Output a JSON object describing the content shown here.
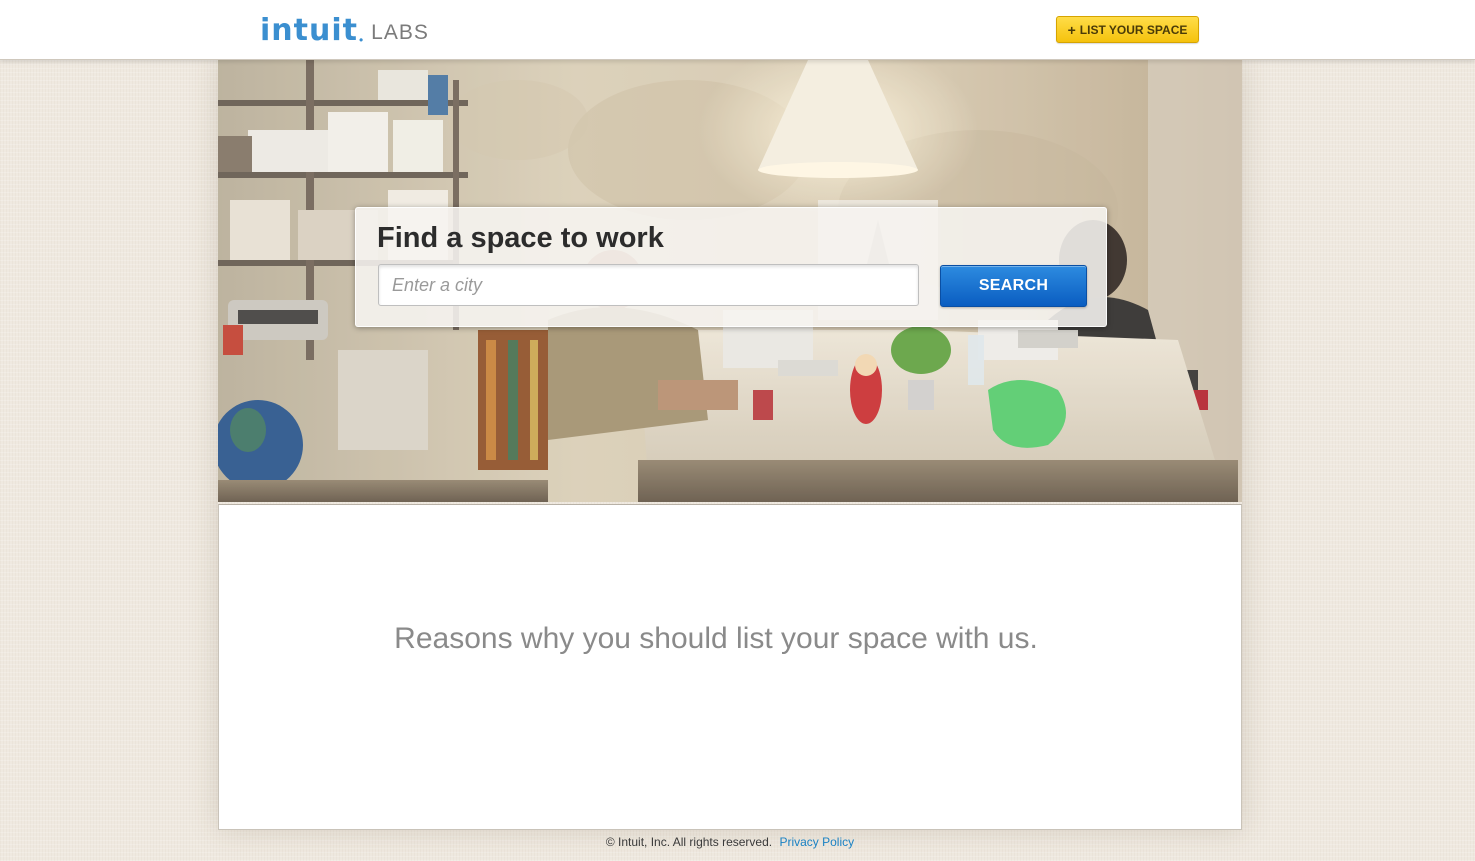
{
  "header": {
    "logo_brand": "intuit",
    "logo_sub": "LABS",
    "list_button": {
      "plus": "+",
      "label": "LIST YOUR SPACE"
    }
  },
  "hero": {
    "image_subject": "office workspace with people working at desks",
    "search": {
      "title": "Find a space to work",
      "placeholder": "Enter a city",
      "value": "",
      "button_label": "SEARCH"
    }
  },
  "main": {
    "reasons_heading": "Reasons why you should list your space with us."
  },
  "footer": {
    "copyright": "© Intuit, Inc. All rights reserved.",
    "privacy_link": "Privacy Policy"
  },
  "colors": {
    "brand_blue": "#3b8fd0",
    "list_button_yellow": "#f5c20d",
    "search_button_blue": "#0a5dc1",
    "link_blue": "#1a82c4",
    "page_background": "#efe9e0"
  },
  "icons": [
    "plus-icon"
  ]
}
